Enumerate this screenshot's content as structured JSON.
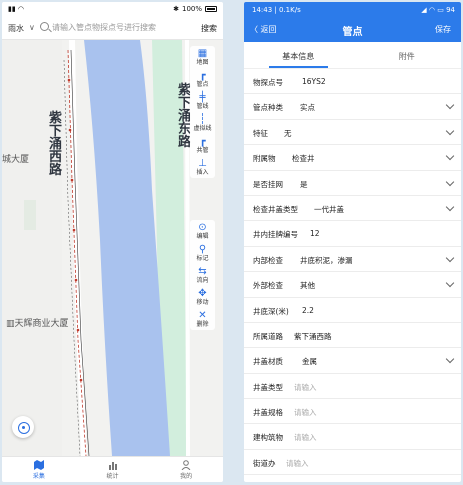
{
  "left": {
    "status": {
      "left": "",
      "battery": "100%"
    },
    "search": {
      "region": "雨水",
      "placeholder": "请输入管点物探点号进行搜索",
      "button": "搜索"
    },
    "map_labels": {
      "road1": "紫下涌西路",
      "road2": "紫下涌东路",
      "building1": "城大厦",
      "building2": "天辉商业大厦"
    },
    "tools_top": [
      {
        "icon": "map-icon",
        "glyph": "▦",
        "label": "地图"
      },
      {
        "icon": "pipe-point-icon",
        "glyph": "┏",
        "label": "管点"
      },
      {
        "icon": "pipe-line-icon",
        "glyph": "╪",
        "label": "管线"
      },
      {
        "icon": "virtual-line-icon",
        "glyph": "┆",
        "label": "虚拟线"
      },
      {
        "icon": "shared-pipe-icon",
        "glyph": "┏",
        "label": "共管"
      },
      {
        "icon": "insert-icon",
        "glyph": "⊥",
        "label": "插入"
      }
    ],
    "tools_bottom": [
      {
        "icon": "edit-icon",
        "glyph": "⊙",
        "label": "编辑"
      },
      {
        "icon": "mark-icon",
        "glyph": "⚲",
        "label": "标记"
      },
      {
        "icon": "flow-icon",
        "glyph": "⇆",
        "label": "流向"
      },
      {
        "icon": "move-icon",
        "glyph": "✥",
        "label": "移动"
      },
      {
        "icon": "delete-icon",
        "glyph": "✕",
        "label": "删除"
      }
    ],
    "tabs": [
      {
        "label": "采集",
        "active": true
      },
      {
        "label": "统计",
        "active": false
      },
      {
        "label": "我的",
        "active": false
      }
    ]
  },
  "right": {
    "status": {
      "left": "14:43 | 0.1K/s",
      "right": "94"
    },
    "header": {
      "back": "〈 返回",
      "title": "管点",
      "save": "保存"
    },
    "tabs": [
      {
        "label": "基本信息",
        "active": true
      },
      {
        "label": "附件",
        "active": false
      }
    ],
    "rows": [
      {
        "label": "物探点号",
        "value": "16YS2",
        "placeholder": "",
        "dropdown": false,
        "vx": 58
      },
      {
        "label": "管点种类",
        "value": "实点",
        "placeholder": "",
        "dropdown": true,
        "vx": 56
      },
      {
        "label": "特征",
        "value": "无",
        "placeholder": "",
        "dropdown": true,
        "vx": 40
      },
      {
        "label": "附属物",
        "value": "检查井",
        "placeholder": "",
        "dropdown": true,
        "vx": 48
      },
      {
        "label": "是否挂网",
        "value": "是",
        "placeholder": "",
        "dropdown": true,
        "vx": 56
      },
      {
        "label": "检查井盖类型",
        "value": "一代井盖",
        "placeholder": "",
        "dropdown": true,
        "vx": 70
      },
      {
        "label": "井内挂牌编号",
        "value": "12",
        "placeholder": "",
        "dropdown": false,
        "vx": 66
      },
      {
        "label": "内部检查",
        "value": "井底积泥，渗漏",
        "placeholder": "",
        "dropdown": true,
        "vx": 56
      },
      {
        "label": "外部检查",
        "value": "其他",
        "placeholder": "",
        "dropdown": true,
        "vx": 56
      },
      {
        "label": "井底深(米)",
        "value": "2.2",
        "placeholder": "",
        "dropdown": false,
        "vx": 58
      },
      {
        "label": "所属道路",
        "value": "紫下涌西路",
        "placeholder": "",
        "dropdown": false,
        "vx": 50
      },
      {
        "label": "井盖材质",
        "value": "金属",
        "placeholder": "",
        "dropdown": true,
        "vx": 58
      },
      {
        "label": "井盖类型",
        "value": "",
        "placeholder": "请输入",
        "dropdown": false,
        "vx": 50
      },
      {
        "label": "井盖规格",
        "value": "",
        "placeholder": "请输入",
        "dropdown": false,
        "vx": 50
      },
      {
        "label": "建构筑物",
        "value": "",
        "placeholder": "请输入",
        "dropdown": false,
        "vx": 50
      },
      {
        "label": "街道办",
        "value": "",
        "placeholder": "请输入",
        "dropdown": false,
        "vx": 42
      }
    ]
  },
  "colors": {
    "accent": "#2c7bea",
    "river": "#a9c2ee",
    "park": "#d2eedd"
  }
}
